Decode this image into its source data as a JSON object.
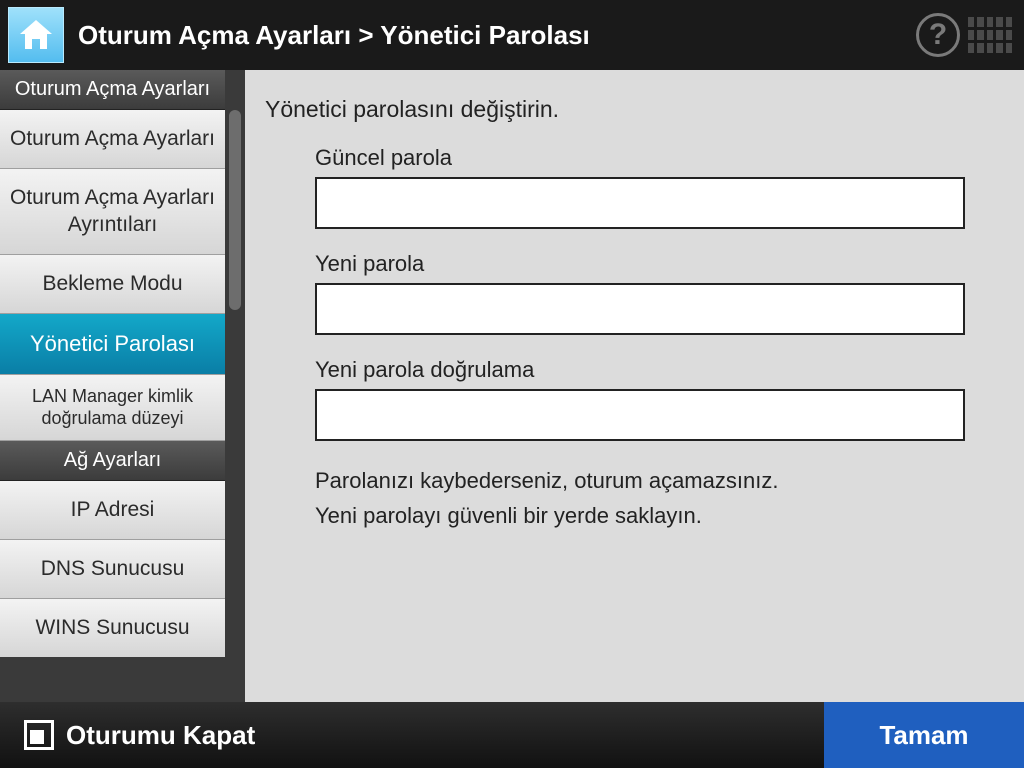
{
  "header": {
    "breadcrumb": "Oturum Açma Ayarları > Yönetici Parolası"
  },
  "sidebar": {
    "group1_header": "Oturum Açma Ayarları",
    "items1": [
      "Oturum Açma Ayarları",
      "Oturum Açma Ayarları Ayrıntıları",
      "Bekleme Modu",
      "Yönetici Parolası",
      "LAN Manager kimlik doğrulama düzeyi"
    ],
    "active_index": 3,
    "group2_header": "Ağ Ayarları",
    "items2": [
      "IP Adresi",
      "DNS Sunucusu",
      "WINS Sunucusu"
    ]
  },
  "main": {
    "intro": "Yönetici parolasını değiştirin.",
    "current_label": "Güncel parola",
    "current_value": "",
    "new_label": "Yeni parola",
    "new_value": "",
    "confirm_label": "Yeni parola doğrulama",
    "confirm_value": "",
    "note1": "Parolanızı kaybederseniz, oturum açamazsınız.",
    "note2": "Yeni parolayı güvenli bir yerde saklayın."
  },
  "footer": {
    "logout": "Oturumu Kapat",
    "ok": "Tamam"
  }
}
